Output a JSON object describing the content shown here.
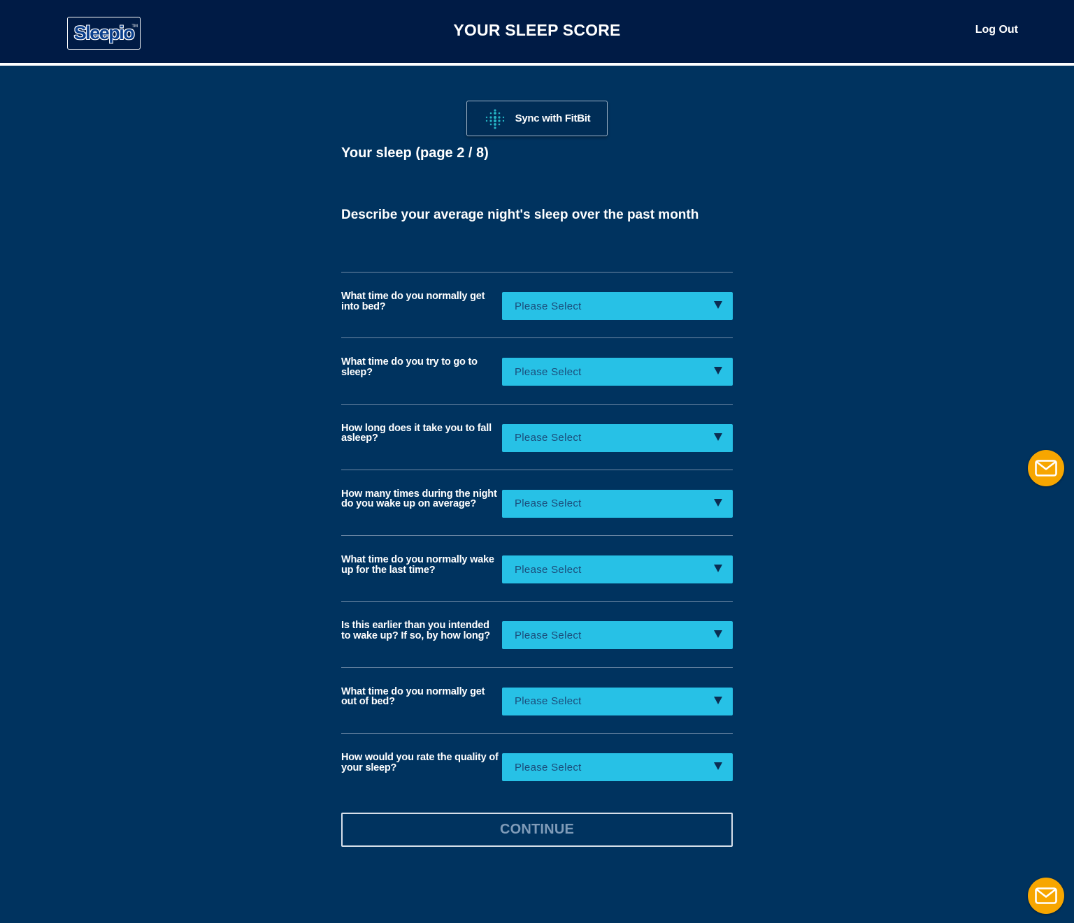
{
  "header": {
    "logo_text": "Sleepio",
    "logo_tm": "TM",
    "title": "YOUR SLEEP SCORE",
    "logout_label": "Log Out"
  },
  "fitbit": {
    "label": "Sync with FitBit",
    "icon": "fitbit-dots-icon"
  },
  "form": {
    "heading": "Your sleep (page 2 / 8)",
    "description": "Describe your average night's sleep over the past month",
    "questions": [
      {
        "label": "What time do you normally get into bed?",
        "value": "Please Select"
      },
      {
        "label": "What time do you try to go to sleep?",
        "value": "Please Select"
      },
      {
        "label": "How long does it take you to fall asleep?",
        "value": "Please Select"
      },
      {
        "label": "How many times during the night do you wake up on average?",
        "value": "Please Select"
      },
      {
        "label": "What time do you normally wake up for the last time?",
        "value": "Please Select"
      },
      {
        "label": "Is this earlier than you intended to wake up? If so, by how long?",
        "value": "Please Select"
      },
      {
        "label": "What time do you normally get out of bed?",
        "value": "Please Select"
      },
      {
        "label": "How would you rate the quality of your sleep?",
        "value": "Please Select"
      }
    ],
    "continue_label": "CONTINUE"
  },
  "floating": {
    "mail_icon": "envelope-icon"
  },
  "colors": {
    "background": "#00335f",
    "header": "#001b45",
    "select": "#27c1e6",
    "accent": "#f7a600"
  }
}
